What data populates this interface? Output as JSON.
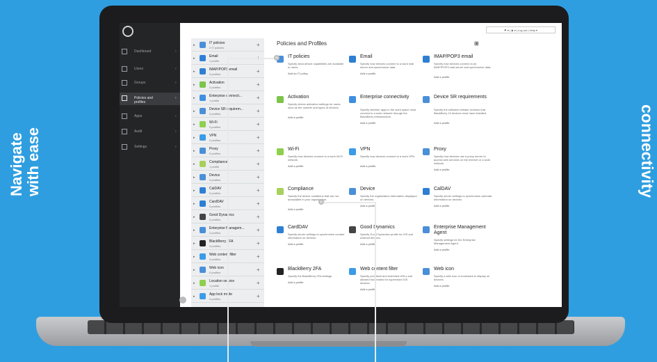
{
  "side_left": [
    "Navigate",
    "with ease"
  ],
  "side_right": "connectivity",
  "topbar": "⚑ ▾  |  ♟ ▾  |  Log out  |  Help  ▾",
  "nav": [
    {
      "label": "Dashboard",
      "icon": "chart-icon",
      "active": false
    },
    {
      "label": "Users",
      "icon": "users-icon",
      "active": false
    },
    {
      "label": "Groups",
      "icon": "groups-icon",
      "active": false
    },
    {
      "label": "Policies and\nprofiles",
      "icon": "policies-icon",
      "active": true
    },
    {
      "label": "Apps",
      "icon": "apps-icon",
      "active": false
    },
    {
      "label": "Audit",
      "icon": "audit-icon",
      "active": false
    },
    {
      "label": "Settings",
      "icon": "settings-icon",
      "active": false
    }
  ],
  "policy_types": [
    {
      "name": "IT policies",
      "count": "2 IT policies",
      "color": "#4a8fd8"
    },
    {
      "name": "Email",
      "count": "1 profile",
      "color": "#2e7fd3"
    },
    {
      "name": "IMAP/POP3 email",
      "count": "0 profiles",
      "color": "#2e7fd3"
    },
    {
      "name": "Activation",
      "count": "2 profiles",
      "color": "#7cc44a"
    },
    {
      "name": "Enterprise connecti...",
      "count": "1 profile",
      "color": "#3f8ee0"
    },
    {
      "name": "Device SR requirem...",
      "count": "0 profiles",
      "color": "#4a8fd8"
    },
    {
      "name": "Wi-Fi",
      "count": "0 profiles",
      "color": "#8fcf4f"
    },
    {
      "name": "VPN",
      "count": "0 profiles",
      "color": "#3c9be6"
    },
    {
      "name": "Proxy",
      "count": "0 profiles",
      "color": "#4a8fd8"
    },
    {
      "name": "Compliance",
      "count": "1 profile",
      "color": "#a8d05c"
    },
    {
      "name": "Device",
      "count": "0 profiles",
      "color": "#4a8fd8"
    },
    {
      "name": "CalDAV",
      "count": "0 profiles",
      "color": "#2e7fd3"
    },
    {
      "name": "CardDAV",
      "count": "0 profiles",
      "color": "#2e7fd3"
    },
    {
      "name": "Good Dynamics",
      "count": "0 profiles",
      "color": "#444444"
    },
    {
      "name": "Enterprise Managem...",
      "count": "2 profiles",
      "color": "#4a8fd8"
    },
    {
      "name": "BlackBerry 2FA",
      "count": "0 profiles",
      "color": "#222222"
    },
    {
      "name": "Web content filter",
      "count": "0 profiles",
      "color": "#3c9be6"
    },
    {
      "name": "Web icon",
      "count": "0 profiles",
      "color": "#4a8fd8"
    },
    {
      "name": "Location service",
      "count": "1 profile",
      "color": "#8fcf4f"
    },
    {
      "name": "App lock mode",
      "count": "0 profiles",
      "color": "#3c9be6"
    }
  ],
  "main_title": "Policies and Profiles",
  "help_icon": "ⓘ",
  "cards": [
    {
      "name": "IT policies",
      "desc": "Specify what device capabilities are available to users.",
      "action": "Add an IT policy",
      "color": "#4a8fd8"
    },
    {
      "name": "Email",
      "desc": "Specify how devices connect to a work mail server and synchronize data.",
      "action": "Add a profile",
      "color": "#2e7fd3"
    },
    {
      "name": "IMAP/POP3 email",
      "desc": "Specify how devices connect to an IMAP/POP3 mail server and synchronize data.",
      "action": "Add a profile",
      "color": "#2e7fd3"
    },
    {
      "name": "Activation",
      "desc": "Specify device activation settings for users, such as the number and types of devices.",
      "action": "Add a profile",
      "color": "#7cc44a"
    },
    {
      "name": "Enterprise connectivity",
      "desc": "Specify whether apps in the work space must connect to a work network through the BlackBerry Infrastructure.",
      "action": "Add a profile",
      "color": "#3f8ee0"
    },
    {
      "name": "Device SR requirements",
      "desc": "Specify the software release versions that BlackBerry 10 devices must have installed.",
      "action": "Add a profile",
      "color": "#4a8fd8"
    },
    {
      "name": "Wi-Fi",
      "desc": "Specify how devices connect to a work Wi-Fi network.",
      "action": "Add a profile",
      "color": "#8fcf4f"
    },
    {
      "name": "VPN",
      "desc": "Specify how devices connect to a work VPN.",
      "action": "Add a profile",
      "color": "#3c9be6"
    },
    {
      "name": "Proxy",
      "desc": "Specify how devices use a proxy server to access web services on the Internet or a work network.",
      "action": "Add a profile",
      "color": "#4a8fd8"
    },
    {
      "name": "Compliance",
      "desc": "Specify the device conditions that are not acceptable in your organization.",
      "action": "Add a profile",
      "color": "#a8d05c"
    },
    {
      "name": "Device",
      "desc": "Specify the organization information displayed on devices.",
      "action": "Add a profile",
      "color": "#4a8fd8"
    },
    {
      "name": "CalDAV",
      "desc": "Specify server settings to synchronize calendar information on devices.",
      "action": "Add a profile",
      "color": "#2e7fd3"
    },
    {
      "name": "CardDAV",
      "desc": "Specify server settings to synchronize contact information on devices.",
      "action": "Add a profile",
      "color": "#2e7fd3"
    },
    {
      "name": "Good Dynamics",
      "desc": "Specify Good Dynamics profile for iOS and Android devices.",
      "action": "Add a profile",
      "color": "#444444"
    },
    {
      "name": "Enterprise Management Agent",
      "desc": "Specify settings for the Enterprise Management Agent.",
      "action": "Add a profile",
      "color": "#4a8fd8"
    },
    {
      "name": "BlackBerry 2FA",
      "desc": "Specify the BlackBerry 2FA settings.",
      "action": "Add a profile",
      "color": "#222222"
    },
    {
      "name": "Web content filter",
      "desc": "Specify permitted and restricted URLs and allowed bookmarks for supervised iOS devices.",
      "action": "Add a profile",
      "color": "#3c9be6"
    },
    {
      "name": "Web icon",
      "desc": "Specify a web icon or bookmark to display on devices.",
      "action": "Add a profile",
      "color": "#4a8fd8"
    }
  ]
}
